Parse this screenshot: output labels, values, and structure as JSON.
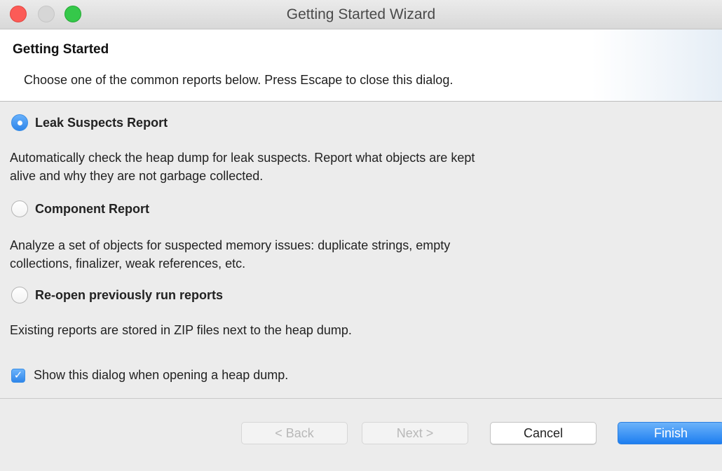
{
  "window": {
    "title": "Getting Started Wizard"
  },
  "header": {
    "title": "Getting Started",
    "description": "Choose one of the common reports below. Press Escape to close this dialog."
  },
  "options": [
    {
      "label": "Leak Suspects Report",
      "selected": true,
      "description_lines": [
        "Automatically check the heap dump for leak suspects. Report what objects are kept",
        "alive and why they are not garbage collected."
      ]
    },
    {
      "label": "Component Report",
      "selected": false,
      "description_lines": [
        "Analyze a set of objects for suspected memory issues: duplicate strings, empty",
        "collections, finalizer, weak references, etc."
      ]
    },
    {
      "label": "Re-open previously run reports",
      "selected": false,
      "description_lines": [
        "Existing reports are stored in ZIP files next to the heap dump."
      ]
    }
  ],
  "show_dialog_checkbox": {
    "label": "Show this dialog when opening a heap dump.",
    "checked": true
  },
  "buttons": {
    "back": "< Back",
    "next": "Next >",
    "cancel": "Cancel",
    "finish": "Finish"
  },
  "colors": {
    "accent": "#2f86ea",
    "close": "#fc5b57",
    "maximize": "#35c84a"
  }
}
